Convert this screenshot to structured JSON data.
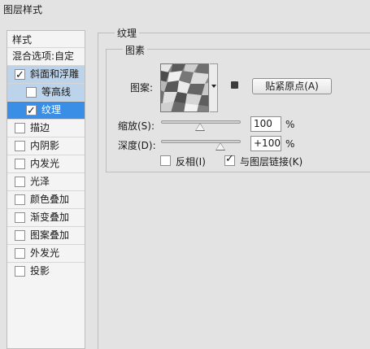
{
  "window": {
    "title": "图层样式"
  },
  "sidebar": {
    "header": "样式",
    "blend_options": "混合选项:自定",
    "items": [
      {
        "label": "斜面和浮雕",
        "checked": true
      },
      {
        "label": "等高线",
        "checked": false
      },
      {
        "label": "纹理",
        "checked": true
      },
      {
        "label": "描边",
        "checked": false
      },
      {
        "label": "内阴影",
        "checked": false
      },
      {
        "label": "内发光",
        "checked": false
      },
      {
        "label": "光泽",
        "checked": false
      },
      {
        "label": "颜色叠加",
        "checked": false
      },
      {
        "label": "渐变叠加",
        "checked": false
      },
      {
        "label": "图案叠加",
        "checked": false
      },
      {
        "label": "外发光",
        "checked": false
      },
      {
        "label": "投影",
        "checked": false
      }
    ]
  },
  "texture_panel": {
    "group_title": "纹理",
    "elements_title": "图素",
    "pattern_label": "图案:",
    "snap_button": "贴紧原点(A)",
    "scale": {
      "label": "缩放(S):",
      "value": "100",
      "unit": "%",
      "level_percent": 50
    },
    "depth": {
      "label": "深度(D):",
      "value": "+100",
      "unit": "%",
      "level_percent": 75
    },
    "invert": {
      "label": "反相(I)",
      "checked": false
    },
    "link_with_layer": {
      "label": "与图层链接(K)",
      "checked": true
    }
  },
  "colors": {
    "selected_bg": "#bcd3ec",
    "active_bg": "#3a8ee6",
    "window_bg": "#e3e3e3"
  }
}
